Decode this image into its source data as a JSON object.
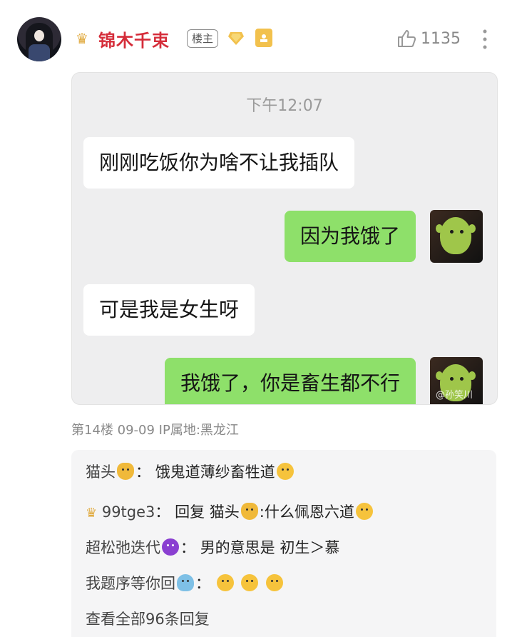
{
  "post": {
    "username": "锦木千束",
    "owner_badge": "楼主",
    "level_badge": "",
    "like_count": "1135"
  },
  "chat": {
    "timestamp": "下午12:07",
    "messages": [
      {
        "side": "left",
        "text": "刚刚吃饭你为啥不让我插队"
      },
      {
        "side": "right",
        "text": "因为我饿了"
      },
      {
        "side": "left",
        "text": "可是我是女生呀"
      },
      {
        "side": "right",
        "text": "我饿了，你是畜生都不行"
      }
    ],
    "watermark": "@孙笑川"
  },
  "meta": {
    "floor_info": "第14楼  09-09  IP属地:黑龙江"
  },
  "replies": [
    {
      "name": "猫头",
      "text": "饿鬼道薄纱畜牲道"
    },
    {
      "name": "99tge3",
      "text": "回复 猫头",
      "text2": ":什么佩恩六道"
    },
    {
      "name": "超松弛迭代",
      "text": "男的意思是 初生＞慕"
    },
    {
      "name": "我题序等你回",
      "text": ""
    }
  ],
  "view_all": "查看全部96条回复",
  "colors": {
    "username": "#d52d3a",
    "right_bubble": "#8ee06a",
    "left_bubble": "#ffffff",
    "chat_bg": "#eeeeef"
  },
  "icons": [
    "crown-icon",
    "diamond-icon",
    "like-icon",
    "more-icon",
    "cat-emoji",
    "devil-emoji",
    "whale-emoji",
    "shocked-emoji"
  ]
}
